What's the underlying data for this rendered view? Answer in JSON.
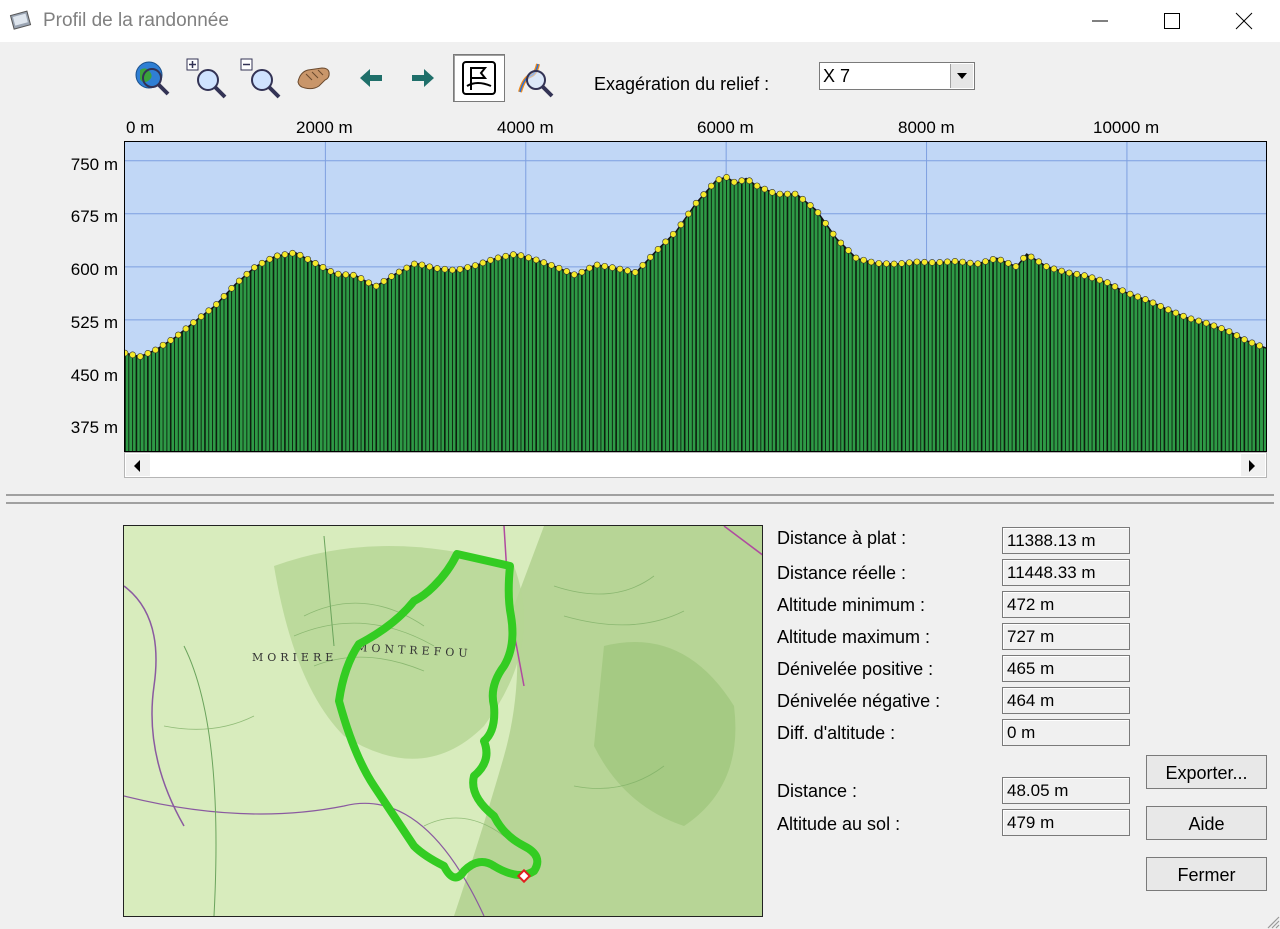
{
  "window": {
    "title": "Profil de la randonnée"
  },
  "toolbar": {
    "tools": [
      {
        "name": "globe-zoom-icon"
      },
      {
        "name": "zoom-in-icon"
      },
      {
        "name": "zoom-out-icon"
      },
      {
        "name": "hand-pan-icon"
      },
      {
        "name": "arrow-left-icon"
      },
      {
        "name": "arrow-right-icon"
      },
      {
        "name": "profile-flag-icon"
      },
      {
        "name": "route-zoom-icon"
      }
    ],
    "exaggeration_label": "Exagération du relief :",
    "exaggeration_value": "X 7"
  },
  "chart_data": {
    "type": "area",
    "x_tick_labels": [
      "0 m",
      "2000 m",
      "4000 m",
      "6000 m",
      "8000 m",
      "10000 m"
    ],
    "y_tick_labels": [
      "750 m",
      "675 m",
      "600 m",
      "525 m",
      "450 m",
      "375 m"
    ],
    "xlim": [
      0,
      11388
    ],
    "ylim": [
      338,
      778
    ],
    "x": [
      0,
      150,
      300,
      500,
      700,
      900,
      1100,
      1300,
      1500,
      1700,
      1900,
      2100,
      2300,
      2500,
      2700,
      2900,
      3100,
      3300,
      3500,
      3700,
      3900,
      4100,
      4300,
      4500,
      4700,
      4900,
      5100,
      5300,
      5500,
      5700,
      5900,
      6000,
      6100,
      6200,
      6300,
      6500,
      6700,
      6900,
      7100,
      7300,
      7500,
      7700,
      7900,
      8100,
      8300,
      8500,
      8700,
      8900,
      9000,
      9200,
      9400,
      9600,
      9800,
      10000,
      10200,
      10400,
      10600,
      10800,
      11000,
      11200,
      11388
    ],
    "y": [
      478,
      473,
      482,
      500,
      523,
      545,
      575,
      600,
      615,
      620,
      605,
      590,
      588,
      572,
      590,
      605,
      598,
      595,
      602,
      612,
      618,
      610,
      600,
      588,
      603,
      598,
      592,
      622,
      650,
      690,
      722,
      727,
      718,
      725,
      715,
      703,
      703,
      680,
      640,
      612,
      605,
      604,
      607,
      606,
      608,
      604,
      612,
      600,
      618,
      600,
      592,
      587,
      578,
      563,
      553,
      540,
      528,
      520,
      510,
      495,
      485
    ],
    "fill_color": "#2e9a46",
    "sky_color": "#c1d7f6",
    "marker_color": "#f5ea2a"
  },
  "stats": [
    {
      "label": "Distance à plat :",
      "value": "11388.13 m"
    },
    {
      "label": "Distance réelle :",
      "value": "11448.33 m"
    },
    {
      "label": "Altitude minimum :",
      "value": "472 m"
    },
    {
      "label": "Altitude maximum :",
      "value": "727 m"
    },
    {
      "label": "Dénivelée positive :",
      "value": "465 m"
    },
    {
      "label": "Dénivelée négative :",
      "value": "464 m"
    },
    {
      "label": "Diff. d'altitude :",
      "value": "0 m"
    }
  ],
  "cursor_stats": [
    {
      "label": "Distance :",
      "value": "48.05 m"
    },
    {
      "label": "Altitude au sol :",
      "value": "479 m"
    }
  ],
  "buttons": {
    "export": "Exporter...",
    "help": "Aide",
    "close": "Fermer"
  },
  "map": {
    "labels": [
      "MORIERE",
      "MONTREFOU"
    ],
    "route_color": "#33cc22",
    "terrain_color": "#cfe6b0"
  }
}
